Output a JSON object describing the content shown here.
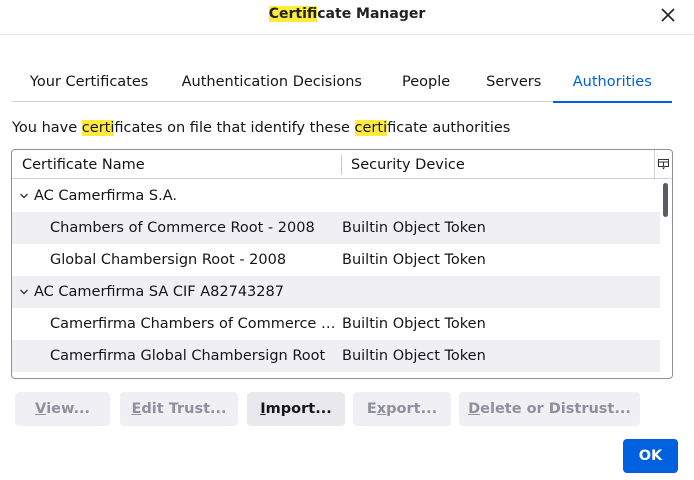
{
  "window": {
    "title_highlight": "Certif",
    "title_rest": "icate Manager"
  },
  "tabs": [
    {
      "label": "Your Certificates",
      "active": false
    },
    {
      "label": "Authentication Decisions",
      "active": false
    },
    {
      "label": "People",
      "active": false
    },
    {
      "label": "Servers",
      "active": false
    },
    {
      "label": "Authorities",
      "active": true
    }
  ],
  "description": {
    "part1": "You have ",
    "hl1": "certi",
    "part2": "ficates on file that identify these ",
    "hl2": "certi",
    "part3": "ficate authorities"
  },
  "tree": {
    "columns": {
      "name": "Certificate Name",
      "device": "Security Device"
    },
    "rows": [
      {
        "type": "group",
        "name": "AC Camerfirma S.A.",
        "device": ""
      },
      {
        "type": "cert",
        "name": "Chambers of Commerce Root - 2008",
        "device": "Builtin Object Token"
      },
      {
        "type": "cert",
        "name": "Global Chambersign Root - 2008",
        "device": "Builtin Object Token"
      },
      {
        "type": "group",
        "name": "AC Camerfirma SA CIF A82743287",
        "device": ""
      },
      {
        "type": "cert",
        "name": "Camerfirma Chambers of Commerce Root",
        "device": "Builtin Object Token"
      },
      {
        "type": "cert",
        "name": "Camerfirma Global Chambersign Root",
        "device": "Builtin Object Token"
      }
    ]
  },
  "buttons": {
    "view": {
      "mnemonic": "V",
      "rest": "iew..."
    },
    "edit": {
      "mnemonic": "E",
      "rest": "dit Trust..."
    },
    "import": {
      "mnemonic": "I",
      "rest": "mport..."
    },
    "export": {
      "mnemonic": "x",
      "pre": "E",
      "rest": "port..."
    },
    "delete": {
      "mnemonic": "D",
      "rest": "elete or Distrust..."
    },
    "ok": "OK"
  },
  "colors": {
    "accent": "#0060df",
    "highlight": "#ffeb3b",
    "primary_button": "#0061e0"
  }
}
